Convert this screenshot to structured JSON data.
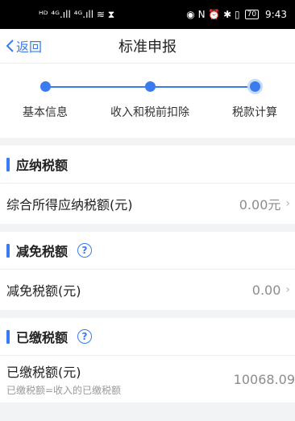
{
  "status_bar": {
    "left_icons": "ᴴᴰ ⁴ᴳ.ıll ⁴ᴳ.ıll ≋ ⧗",
    "right_icons": "◉ N ⏰ ✱ ▯",
    "battery": "70",
    "time": "9:43"
  },
  "nav": {
    "back_label": "返回",
    "title": "标准申报"
  },
  "steps": [
    {
      "label": "基本信息",
      "state": "done"
    },
    {
      "label": "收入和税前扣除",
      "state": "done"
    },
    {
      "label": "税款计算",
      "state": "current"
    }
  ],
  "sections": {
    "payable": {
      "title": "应纳税额",
      "row_label": "综合所得应纳税额(元)",
      "row_value": "0.00元"
    },
    "reduction": {
      "title": "减免税额",
      "row_label": "减免税额(元)",
      "row_value": "0.00"
    },
    "paid": {
      "title": "已缴税额",
      "row_label": "已缴税额(元)",
      "row_sub": "已缴税额=收入的已缴税额",
      "row_value": "10068.09"
    }
  },
  "help_glyph": "?",
  "chevron_glyph": "›",
  "colors": {
    "accent": "#3a7cf0",
    "status_bar": "#000000",
    "background": "#f2f3f5"
  }
}
